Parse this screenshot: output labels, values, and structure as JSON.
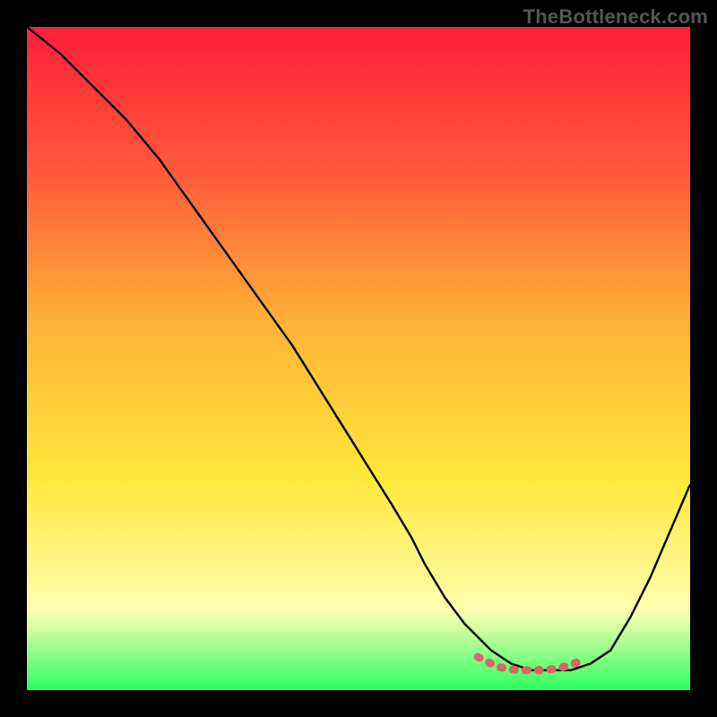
{
  "watermark": "TheBottleneck.com",
  "colors": {
    "frame": "#000000",
    "grad_top": "#ff1f3a",
    "grad_mid1": "#ff5a3a",
    "grad_mid2": "#ffb338",
    "grad_mid3": "#ffe73a",
    "grad_mid4": "#ffffb0",
    "grad_bottom": "#2cff62",
    "curve": "#000000",
    "highlight": "#d96565"
  },
  "chart_data": {
    "type": "line",
    "title": "",
    "xlabel": "",
    "ylabel": "",
    "xlim": [
      0,
      100
    ],
    "ylim": [
      0,
      100
    ],
    "series": [
      {
        "name": "bottleneck-curve",
        "x": [
          0,
          5,
          10,
          15,
          20,
          25,
          30,
          35,
          40,
          45,
          50,
          55,
          58,
          60,
          63,
          66,
          70,
          73,
          76,
          79,
          82,
          85,
          88,
          91,
          94,
          97,
          100
        ],
        "y": [
          100,
          96,
          91,
          86,
          80,
          73,
          66,
          59,
          52,
          44,
          36,
          28,
          23,
          19,
          14,
          10,
          6,
          4,
          3,
          3,
          3,
          4,
          6,
          11,
          17,
          24,
          31
        ]
      }
    ],
    "highlight_segment": {
      "name": "near-minimum",
      "x": [
        68,
        71,
        74,
        77,
        80,
        83
      ],
      "y": [
        5,
        3.5,
        3,
        3,
        3.2,
        4.2
      ]
    },
    "minimum": {
      "x": 77,
      "y": 3
    }
  }
}
